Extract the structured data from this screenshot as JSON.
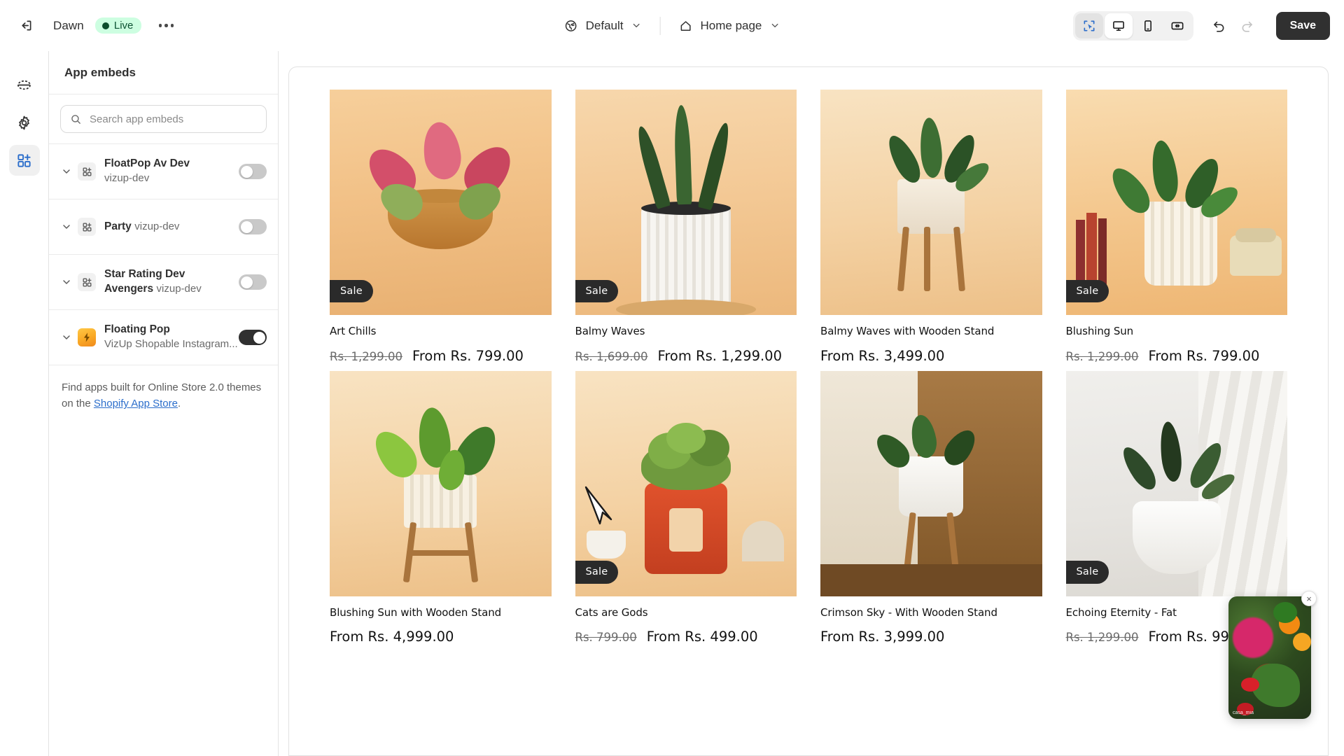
{
  "topbar": {
    "exit_icon": "exit-icon",
    "theme_name": "Dawn",
    "status_label": "Live",
    "more_label": "more-options",
    "locale_icon": "globe-icon",
    "locale_label": "Default",
    "page_icon": "home-icon",
    "page_label": "Home page",
    "view_buttons": [
      {
        "name": "select-tool",
        "icon": "cursor-select-icon",
        "state": "selected"
      },
      {
        "name": "desktop-view",
        "icon": "desktop-icon",
        "state": "active"
      },
      {
        "name": "mobile-view",
        "icon": "mobile-icon",
        "state": "inactive"
      },
      {
        "name": "full-width-view",
        "icon": "arrows-horizontal-icon",
        "state": "inactive"
      }
    ],
    "undo_label": "Undo",
    "redo_label": "Redo",
    "save_label": "Save"
  },
  "rail": [
    {
      "name": "sections-icon",
      "label": "Sections",
      "active": false
    },
    {
      "name": "gear-icon",
      "label": "Theme settings",
      "active": false
    },
    {
      "name": "app-embeds-icon",
      "label": "App embeds",
      "active": true
    }
  ],
  "sidebar": {
    "title": "App embeds",
    "search": {
      "placeholder": "Search app embeds",
      "value": ""
    },
    "embeds": [
      {
        "name": "FloatPop Av Dev",
        "developer": "vizup-dev",
        "icon": "app-generic-icon",
        "enabled": false
      },
      {
        "name": "Party",
        "developer": "vizup-dev",
        "icon": "app-generic-icon",
        "enabled": false
      },
      {
        "name": "Star Rating Dev Avengers",
        "developer": "vizup-dev",
        "icon": "app-generic-icon",
        "enabled": false
      },
      {
        "name": "Floating Pop",
        "developer": "VizUp Shopable Instagram...",
        "icon": "floating-pop-icon",
        "enabled": true
      }
    ],
    "footer": {
      "text_before": "Find apps built for Online Store 2.0 themes on the ",
      "link_text": "Shopify App Store",
      "text_after": "."
    }
  },
  "preview": {
    "products": [
      {
        "title": "Art Chills",
        "on_sale": true,
        "sale_label": "Sale",
        "price_old": "Rs. 1,299.00",
        "price_new": "From Rs. 799.00",
        "image_alt": "pink-aglaonema-in-tan-pot"
      },
      {
        "title": "Balmy Waves",
        "on_sale": true,
        "sale_label": "Sale",
        "price_old": "Rs. 1,699.00",
        "price_new": "From Rs. 1,299.00",
        "image_alt": "snake-plant-in-white-ribbed-pot"
      },
      {
        "title": "Balmy Waves with Wooden Stand",
        "on_sale": false,
        "sale_label": "",
        "price_old": "",
        "price_new": "From Rs. 3,499.00",
        "image_alt": "peace-lily-on-wooden-stand"
      },
      {
        "title": "Blushing Sun",
        "on_sale": true,
        "sale_label": "Sale",
        "price_old": "Rs. 1,299.00",
        "price_new": "From Rs. 799.00",
        "image_alt": "green-plant-in-cream-pot-with-telephone"
      },
      {
        "title": "Blushing Sun with Wooden Stand",
        "on_sale": false,
        "sale_label": "",
        "price_old": "",
        "price_new": "From Rs. 4,999.00",
        "image_alt": "leafy-plant-on-wooden-stand"
      },
      {
        "title": "Cats are Gods",
        "on_sale": true,
        "sale_label": "Sale",
        "price_old": "Rs. 799.00",
        "price_new": "From Rs. 499.00",
        "image_alt": "bonsai-in-red-square-pot"
      },
      {
        "title": "Crimson Sky - With Wooden Stand",
        "on_sale": false,
        "sale_label": "",
        "price_old": "",
        "price_new": "From Rs. 3,999.00",
        "image_alt": "plant-in-white-pot-on-tall-wooden-stand"
      },
      {
        "title": "Echoing Eternity - Fat",
        "on_sale": true,
        "sale_label": "Sale",
        "price_old": "Rs. 1,299.00",
        "price_new": "From Rs. 999.00",
        "image_alt": "dark-leaf-plant-in-white-pot-by-curtain"
      }
    ],
    "float_widget": {
      "handle": "casa_mia",
      "close_label": "×"
    }
  },
  "colors": {
    "accent_blue": "#2c6ecb",
    "live_badge_bg": "#cdfee1",
    "live_badge_text": "#0c5132",
    "save_bg": "#303030",
    "toggle_on": "#303030",
    "toggle_off": "#c9c9c9"
  }
}
